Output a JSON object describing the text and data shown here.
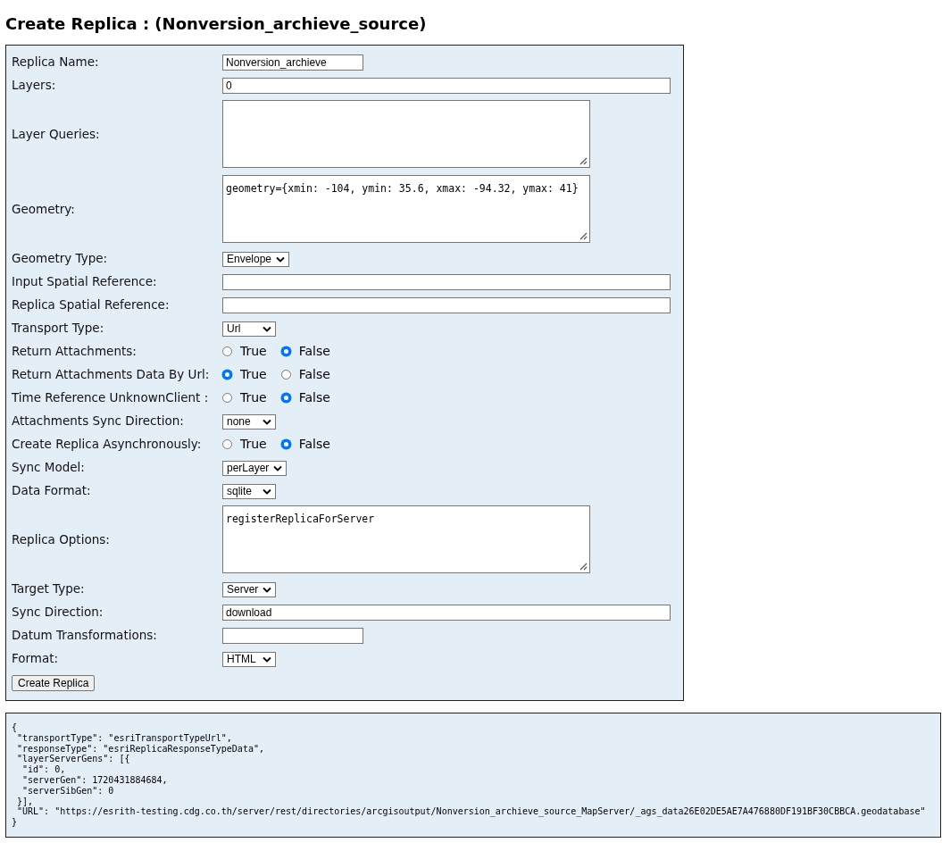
{
  "title": "Create Replica : (Nonversion_archieve_source)",
  "fields": [
    {
      "label": "Replica Name:",
      "kind": "text",
      "wide": false,
      "value": "Nonversion_archieve"
    },
    {
      "label": "Layers:",
      "kind": "text",
      "wide": true,
      "value": "0"
    },
    {
      "label": "Layer Queries:",
      "kind": "textarea"
    },
    {
      "label": "Geometry:",
      "kind": "textarea",
      "value": "geometry={xmin: -104, ymin: 35.6, xmax: -94.32, ymax: 41}"
    },
    {
      "label": "Geometry Type:",
      "kind": "select",
      "value": "Envelope"
    },
    {
      "label": "Input Spatial Reference:",
      "kind": "text",
      "wide": true
    },
    {
      "label": "Replica Spatial Reference:",
      "kind": "text",
      "wide": true
    },
    {
      "label": "Transport Type:",
      "kind": "select",
      "value": "Url"
    },
    {
      "label": "Return Attachments:",
      "kind": "radio",
      "options": [
        {
          "label": "True",
          "selected": false
        },
        {
          "label": "False",
          "selected": true
        }
      ]
    },
    {
      "label": "Return Attachments Data By Url:",
      "kind": "radio",
      "options": [
        {
          "label": "True",
          "selected": true
        },
        {
          "label": "False",
          "selected": false
        }
      ]
    },
    {
      "label": "Time Reference UnknownClient :",
      "kind": "radio",
      "options": [
        {
          "label": "True",
          "selected": false
        },
        {
          "label": "False",
          "selected": true
        }
      ]
    },
    {
      "label": "Attachments Sync Direction:",
      "kind": "select",
      "value": "none"
    },
    {
      "label": "Create Replica Asynchronously:",
      "kind": "radio",
      "options": [
        {
          "label": "True",
          "selected": false
        },
        {
          "label": "False",
          "selected": true
        }
      ]
    },
    {
      "label": "Sync Model:",
      "kind": "select",
      "value": "perLayer"
    },
    {
      "label": "Data Format:",
      "kind": "select",
      "value": "sqlite"
    },
    {
      "label": "Replica Options:",
      "kind": "textarea",
      "value": "registerReplicaForServer"
    },
    {
      "label": "Target Type:",
      "kind": "select",
      "value": "Server"
    },
    {
      "label": "Sync Direction:",
      "kind": "text",
      "wide": true,
      "value": "download"
    },
    {
      "label": "Datum Transformations:",
      "kind": "text",
      "wide": false
    },
    {
      "label": "Format:",
      "kind": "select",
      "value": "HTML"
    }
  ],
  "submit": "Create Replica",
  "response_lines": [
    "{",
    " \"transportType\": \"esriTransportTypeUrl\",",
    " \"responseType\": \"esriReplicaResponseTypeData\",",
    " \"layerServerGens\": [{",
    "  \"id\": 0,",
    "  \"serverGen\": 1720431884684,",
    "  \"serverSibGen\": 0",
    " }],",
    " \"URL\": \"https://esrith-testing.cdg.co.th/server/rest/directories/arcgisoutput/Nonversion_archieve_source_MapServer/_ags_data26E02DE5AE7A476880DF191BF30CBBCA.geodatabase\"",
    "}"
  ]
}
